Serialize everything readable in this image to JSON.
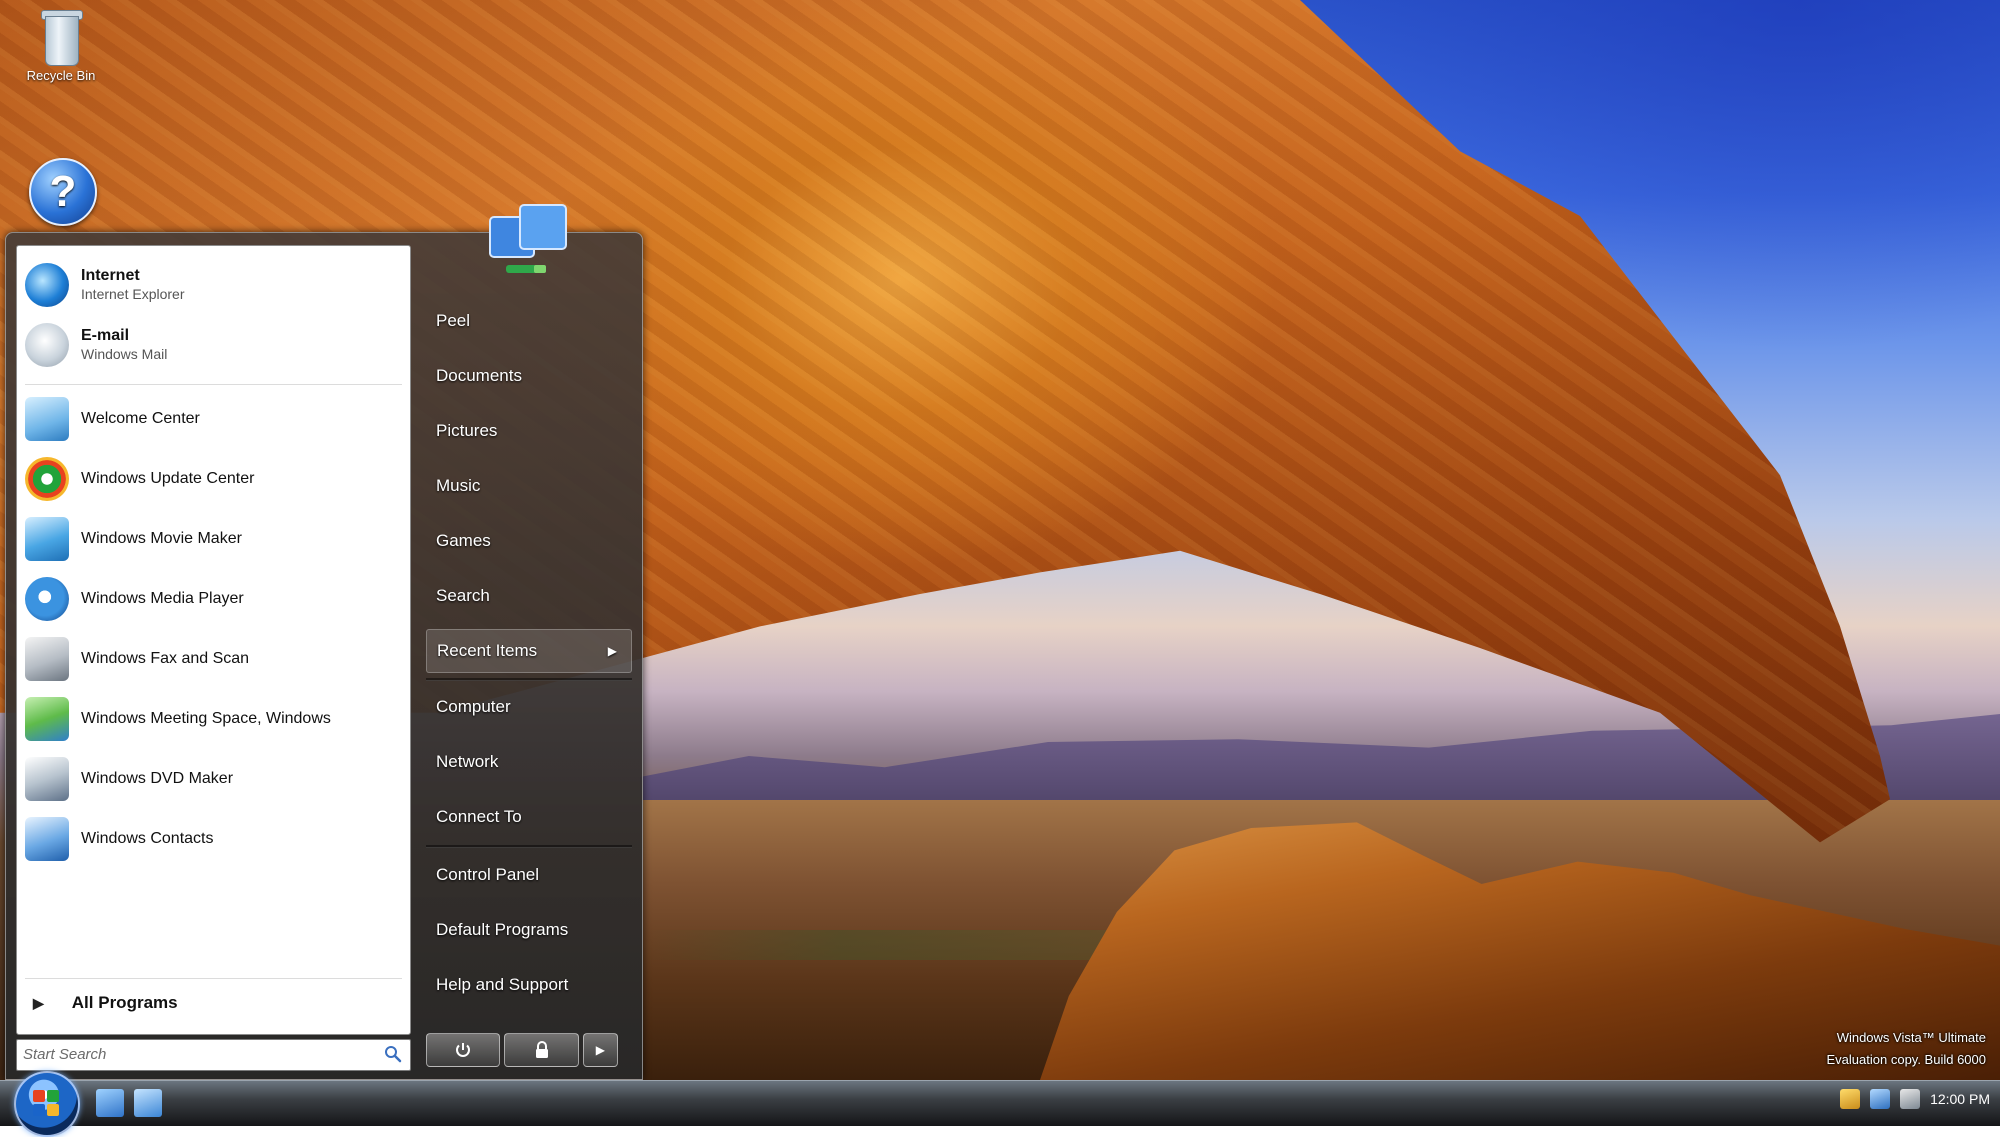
{
  "desktop": {
    "icons": [
      {
        "label": "Recycle Bin",
        "icon": "recycle-bin-icon"
      },
      {
        "label": "",
        "icon": "help-icon"
      }
    ],
    "branding": {
      "line1": "Windows Vista™ Ultimate",
      "line2": "Evaluation copy. Build 6000"
    }
  },
  "start_menu": {
    "pinned": [
      {
        "title": "Internet",
        "subtitle": "Internet Explorer",
        "icon": "internet-explorer-icon"
      },
      {
        "title": "E-mail",
        "subtitle": "Windows Mail",
        "icon": "mail-icon"
      }
    ],
    "recent": [
      {
        "label": "Welcome Center",
        "icon": "welcome-center-icon"
      },
      {
        "label": "Windows Update Center",
        "icon": "windows-update-icon"
      },
      {
        "label": "Windows Movie Maker",
        "icon": "movie-maker-icon"
      },
      {
        "label": "Windows Media Player",
        "icon": "media-player-icon"
      },
      {
        "label": "Windows Fax and Scan",
        "icon": "fax-scan-icon"
      },
      {
        "label": "Windows Meeting Space, Windows",
        "icon": "meeting-space-icon"
      },
      {
        "label": "Windows DVD Maker",
        "icon": "dvd-maker-icon"
      },
      {
        "label": "Windows Contacts",
        "icon": "contacts-icon"
      }
    ],
    "all_programs_label": "All Programs",
    "search_placeholder": "Start Search",
    "right_items": [
      {
        "label": "Peel"
      },
      {
        "label": "Documents"
      },
      {
        "label": "Pictures"
      },
      {
        "label": "Music"
      },
      {
        "label": "Games"
      },
      {
        "label": "Search"
      },
      {
        "label": "Recent Items"
      },
      {
        "label": "Computer"
      },
      {
        "label": "Network"
      },
      {
        "label": "Connect To"
      },
      {
        "label": "Control Panel"
      },
      {
        "label": "Default Programs"
      },
      {
        "label": "Help and Support"
      }
    ]
  },
  "taskbar": {
    "quick_launch": [
      "show-desktop-icon",
      "switch-windows-icon"
    ],
    "clock": "12:00 PM"
  },
  "colors": {
    "taskbar_top": "#6b7580",
    "start_orb": "#1d66c6",
    "flag_red": "#e8421f",
    "flag_green": "#22a33a",
    "flag_blue": "#1a64c9",
    "flag_yellow": "#f6b72c"
  }
}
